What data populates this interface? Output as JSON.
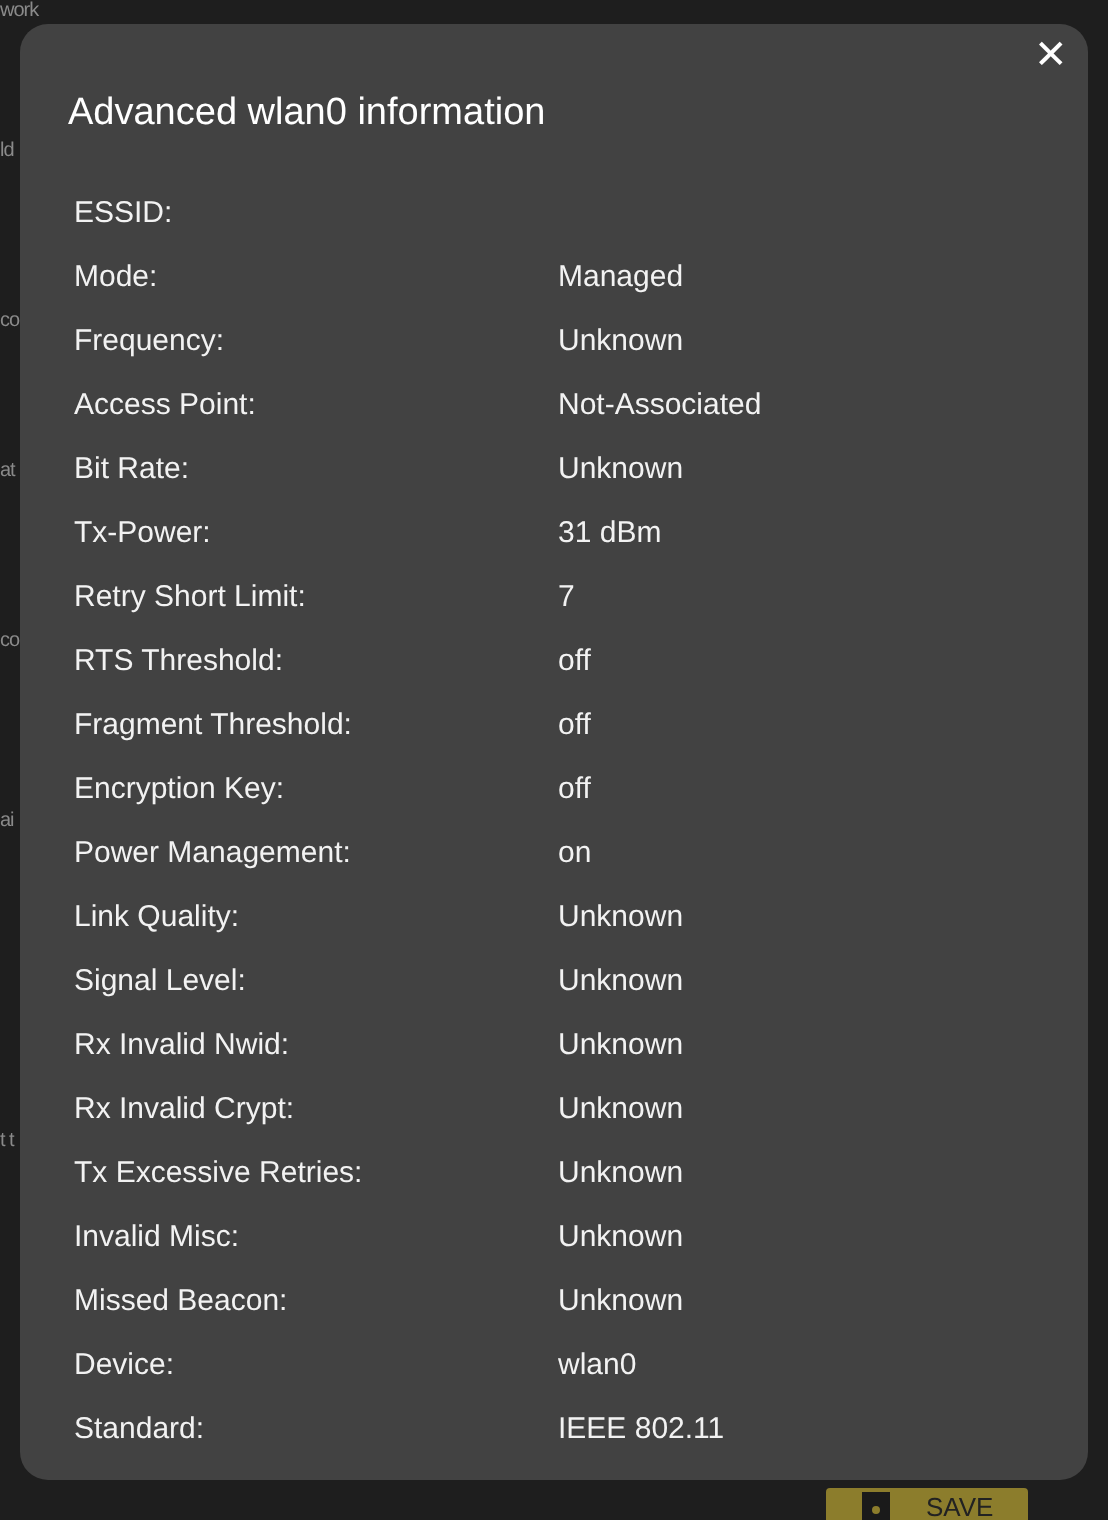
{
  "background": {
    "heading": "work",
    "fragments": [
      "ld",
      "co",
      "at",
      "co",
      "ai",
      "t t"
    ],
    "save_button": "SAVE"
  },
  "dialog": {
    "title": "Advanced wlan0 information",
    "close": "✕",
    "rows": [
      {
        "label": "ESSID:",
        "value": ""
      },
      {
        "label": "Mode:",
        "value": "Managed"
      },
      {
        "label": "Frequency:",
        "value": "Unknown"
      },
      {
        "label": "Access Point:",
        "value": "Not-Associated"
      },
      {
        "label": "Bit Rate:",
        "value": "Unknown"
      },
      {
        "label": "Tx-Power:",
        "value": "31 dBm"
      },
      {
        "label": "Retry Short Limit:",
        "value": "7"
      },
      {
        "label": "RTS Threshold:",
        "value": "off"
      },
      {
        "label": "Fragment Threshold:",
        "value": "off"
      },
      {
        "label": "Encryption Key:",
        "value": "off"
      },
      {
        "label": "Power Management:",
        "value": "on"
      },
      {
        "label": "Link Quality:",
        "value": "Unknown"
      },
      {
        "label": "Signal Level:",
        "value": "Unknown"
      },
      {
        "label": "Rx Invalid Nwid:",
        "value": "Unknown"
      },
      {
        "label": "Rx Invalid Crypt:",
        "value": "Unknown"
      },
      {
        "label": "Tx Excessive Retries:",
        "value": "Unknown"
      },
      {
        "label": "Invalid Misc:",
        "value": "Unknown"
      },
      {
        "label": "Missed Beacon:",
        "value": "Unknown"
      },
      {
        "label": "Device:",
        "value": "wlan0"
      },
      {
        "label": "Standard:",
        "value": "IEEE 802.11"
      }
    ]
  }
}
